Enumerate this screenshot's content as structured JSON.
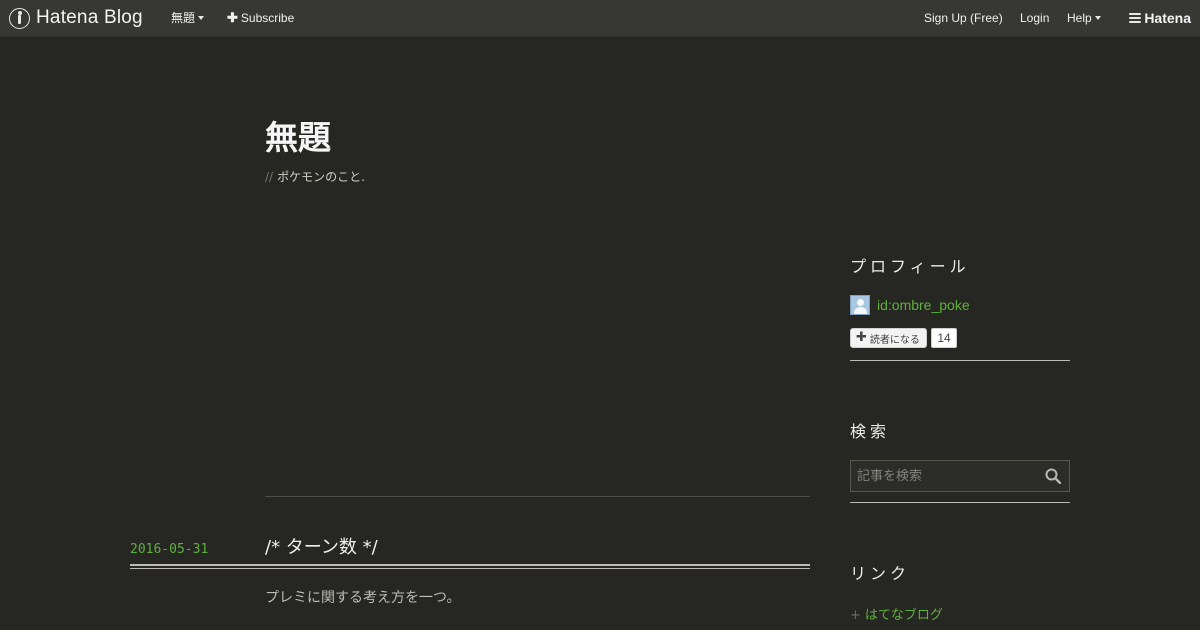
{
  "navbar": {
    "brand": "Hatena Blog",
    "blog_menu": "無題",
    "subscribe": "Subscribe",
    "sign_up": "Sign Up (Free)",
    "login": "Login",
    "help": "Help",
    "hatena": "Hatena"
  },
  "blog": {
    "title": "無題",
    "description_prefix": "//",
    "description": "ポケモンのこと."
  },
  "entry": {
    "date": "2016-05-31",
    "title": "/* ターン数 */",
    "body": "プレミに関する考え方を一つ。"
  },
  "sidebar": {
    "profile": {
      "heading": "プロフィール",
      "user_id": "id:ombre_poke",
      "subscribe_label": "読者になる",
      "subscriber_count": "14"
    },
    "search": {
      "heading": "検索",
      "placeholder": "記事を検索"
    },
    "links": {
      "heading": "リンク",
      "bullet": "+",
      "items": [
        {
          "label": "はてなブログ"
        }
      ]
    }
  },
  "colors": {
    "background": "#262622",
    "topbar": "#373734",
    "accent_green": "#5fb13e",
    "text": "#cfcfc7"
  }
}
